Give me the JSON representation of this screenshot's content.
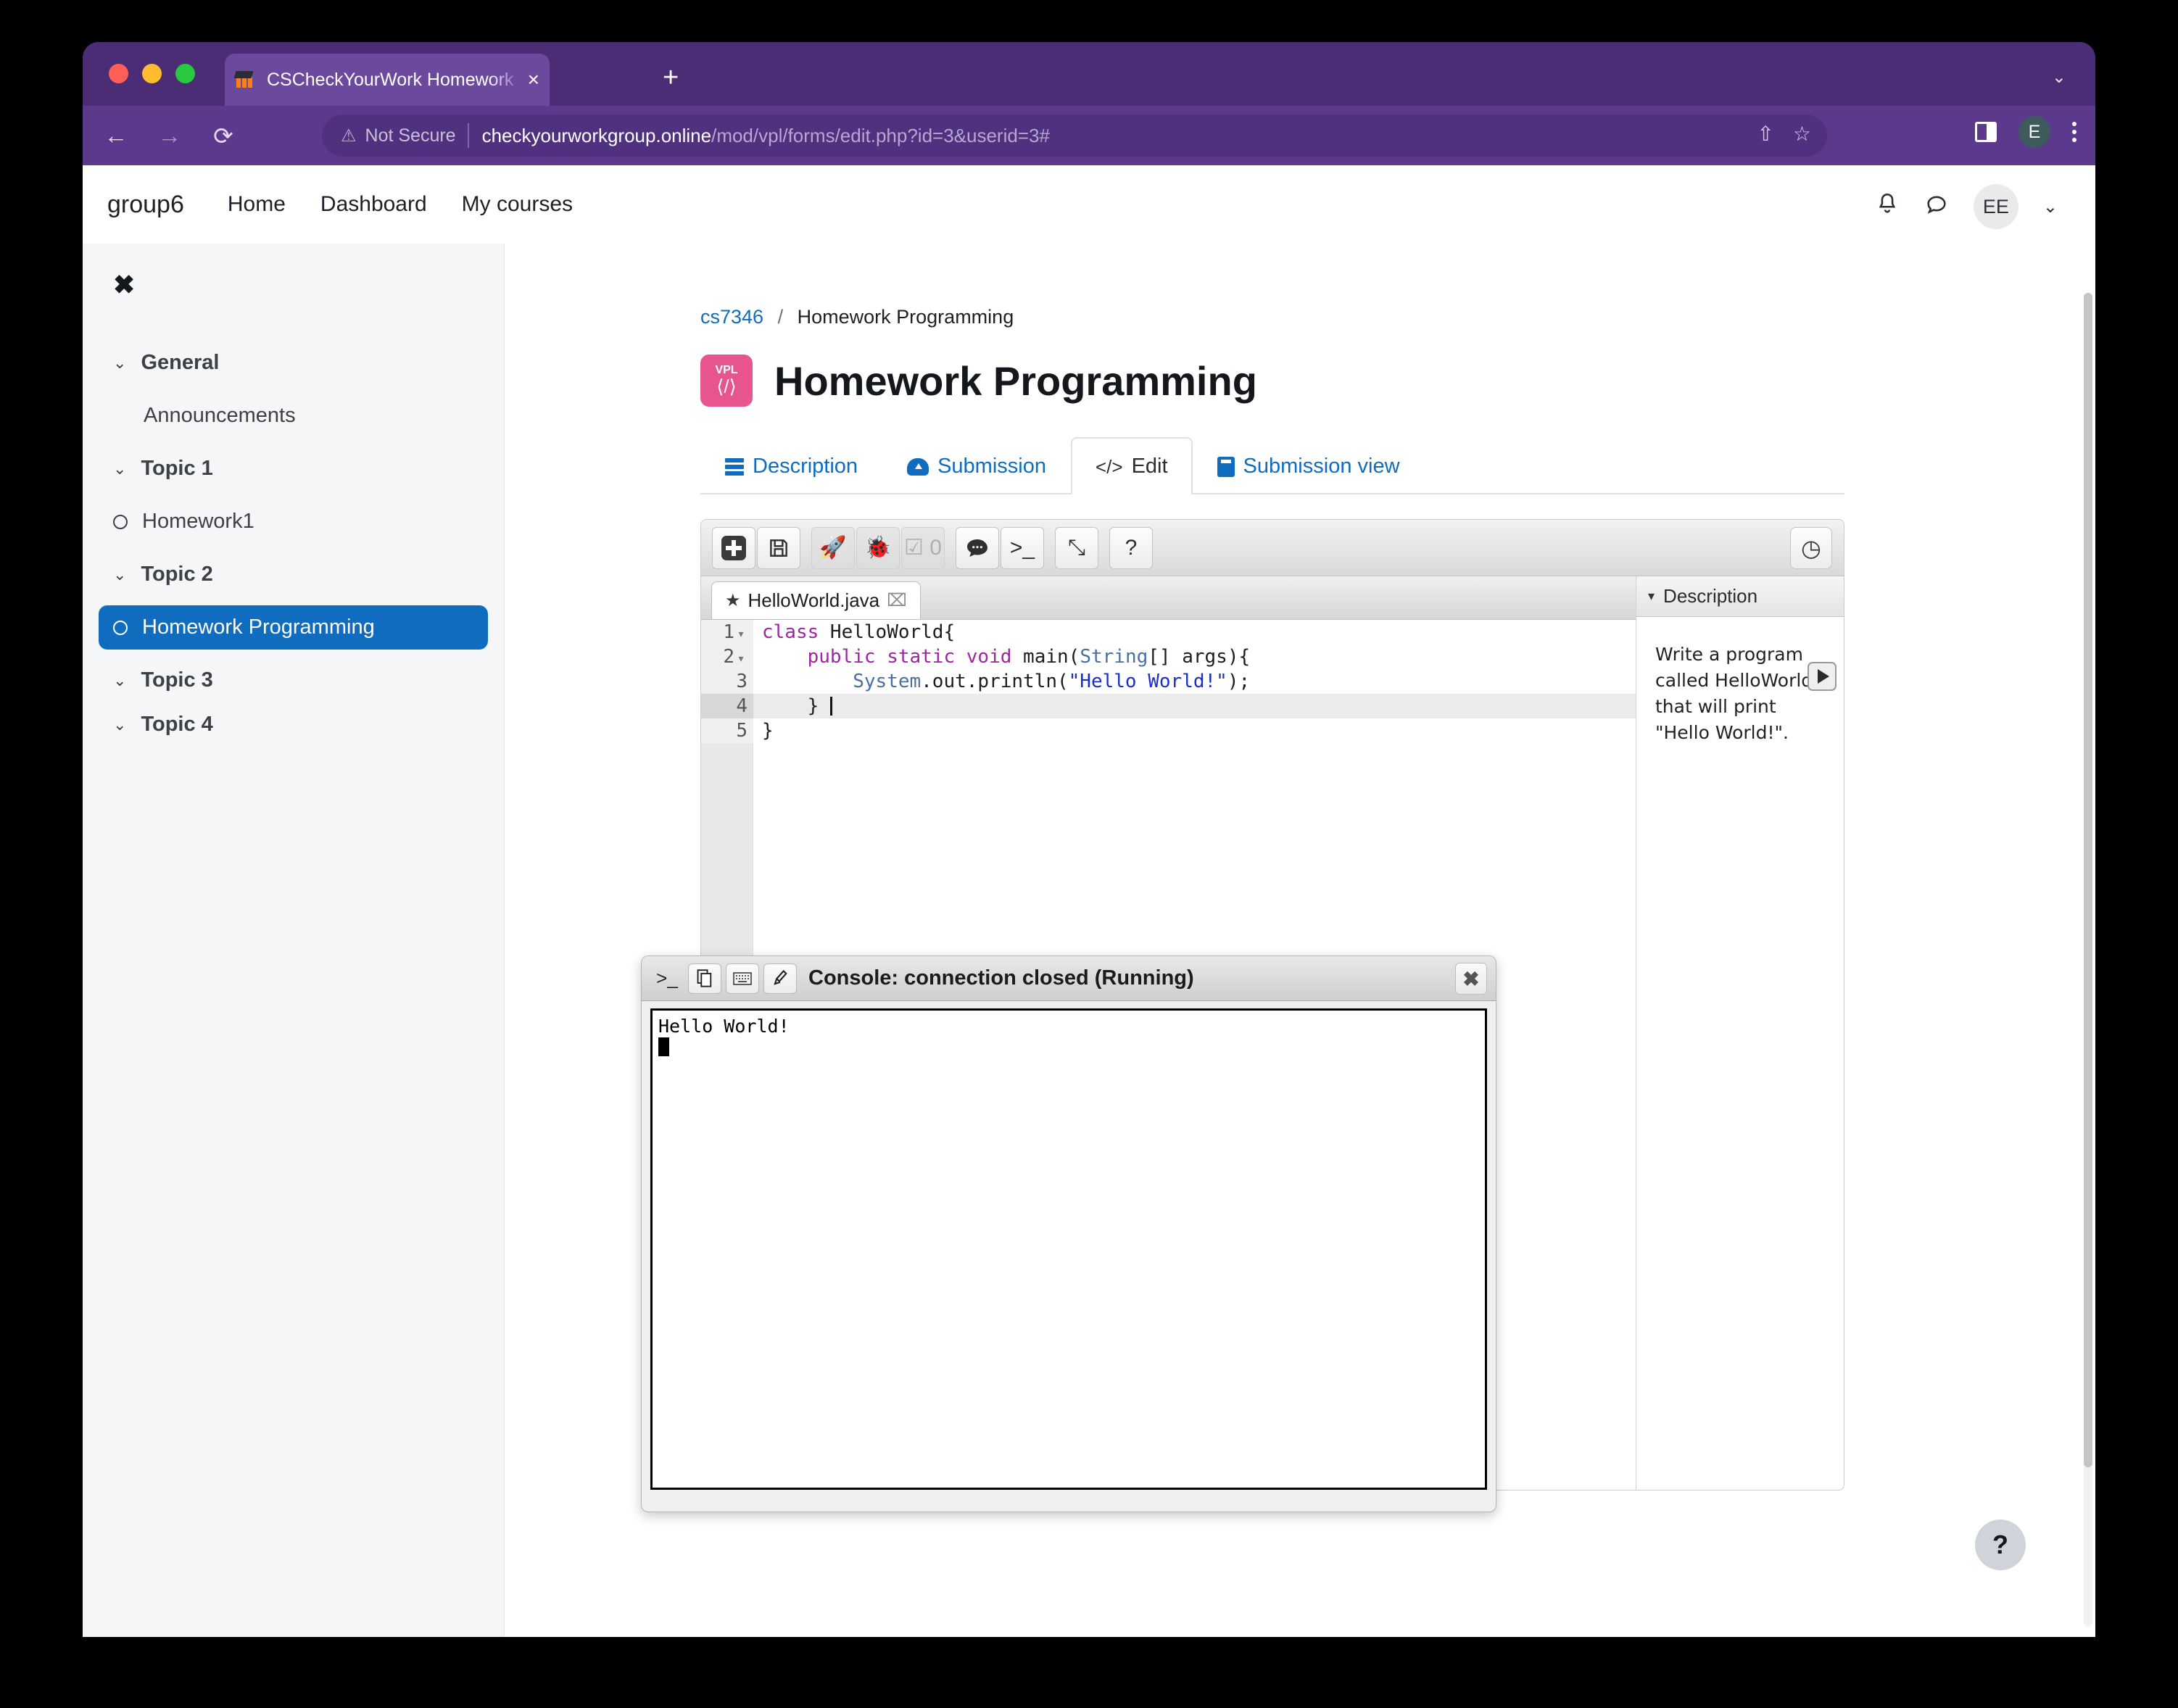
{
  "browser": {
    "tab_title": "CSCheckYourWork Homework",
    "tab_close": "×",
    "new_tab": "+",
    "tabstrip_chevron": "⌄",
    "back": "←",
    "forward": "→",
    "reload": "⟳",
    "warn_glyph": "⚠",
    "security_label": "Not Secure",
    "url_host": "checkyourworkgroup.online",
    "url_path": "/mod/vpl/forms/edit.php?id=3&userid=3#",
    "share_icon": "⇧",
    "bookmark_icon": "☆",
    "profile_initial": "E"
  },
  "moodle_nav": {
    "brand": "group6",
    "links": [
      "Home",
      "Dashboard",
      "My courses"
    ],
    "bell": "🔔",
    "message": "💬",
    "avatar_initials": "EE",
    "chevron": "⌄"
  },
  "course_index": {
    "close_glyph": "✖",
    "chevron": "⌄",
    "entries": [
      {
        "type": "section",
        "label": "General"
      },
      {
        "type": "item",
        "label": "Announcements",
        "bullet": false,
        "active": false
      },
      {
        "type": "section",
        "label": "Topic 1"
      },
      {
        "type": "item",
        "label": "Homework1",
        "bullet": true,
        "active": false
      },
      {
        "type": "section",
        "label": "Topic 2"
      },
      {
        "type": "item",
        "label": "Homework Programming",
        "bullet": true,
        "active": true
      },
      {
        "type": "section",
        "label": "Topic 3"
      },
      {
        "type": "section",
        "label": "Topic 4"
      }
    ]
  },
  "breadcrumb": {
    "course": "cs7346",
    "separator": "/",
    "current": "Homework Programming"
  },
  "page_title": "Homework Programming",
  "vpl_badge": {
    "label": "VPL",
    "glyph": "⟨/⟩"
  },
  "tabs": [
    {
      "label": "Description",
      "icon": "description-icon",
      "active": false
    },
    {
      "label": "Submission",
      "icon": "cloud-upload-icon",
      "active": false
    },
    {
      "label": "Edit",
      "icon": "code-icon",
      "active": true
    },
    {
      "label": "Submission view",
      "icon": "submission-view-icon",
      "active": false
    }
  ],
  "ide": {
    "toolbar": [
      {
        "name": "new-file",
        "glyph": "",
        "disabled": false
      },
      {
        "name": "save",
        "glyph": "💾",
        "disabled": false
      },
      {
        "name": "run",
        "glyph": "🚀",
        "disabled": true
      },
      {
        "name": "debug",
        "glyph": "🐞",
        "disabled": true
      },
      {
        "name": "evaluate",
        "glyph": "☑ 0",
        "disabled": true
      },
      {
        "name": "comments",
        "glyph": "💬",
        "disabled": false
      },
      {
        "name": "console",
        "glyph": ">_",
        "disabled": false
      },
      {
        "name": "fullscreen",
        "glyph": "⤡",
        "disabled": false
      },
      {
        "name": "help",
        "glyph": "?",
        "disabled": false
      }
    ],
    "timer_glyph": "◷",
    "file_tab": {
      "star": "★",
      "name": "HelloWorld.java",
      "close": "⌧"
    },
    "code_lines": [
      {
        "num": "1",
        "fold": "▾",
        "active": false,
        "tokens": [
          {
            "t": "class ",
            "c": "kw"
          },
          {
            "t": "HelloWorld{",
            "c": "plain"
          }
        ]
      },
      {
        "num": "2",
        "fold": "▾",
        "active": false,
        "tokens": [
          {
            "t": "    ",
            "c": "plain"
          },
          {
            "t": "public static void ",
            "c": "kw"
          },
          {
            "t": "main(",
            "c": "plain"
          },
          {
            "t": "String",
            "c": "type"
          },
          {
            "t": "[] args){",
            "c": "plain"
          }
        ]
      },
      {
        "num": "3",
        "fold": "",
        "active": false,
        "tokens": [
          {
            "t": "        ",
            "c": "plain"
          },
          {
            "t": "System",
            "c": "type"
          },
          {
            "t": ".out.println(",
            "c": "plain"
          },
          {
            "t": "\"Hello World!\"",
            "c": "str"
          },
          {
            "t": ");",
            "c": "plain"
          }
        ]
      },
      {
        "num": "4",
        "fold": "",
        "active": true,
        "tokens": [
          {
            "t": "    } ",
            "c": "plain"
          }
        ]
      },
      {
        "num": "5",
        "fold": "",
        "active": false,
        "tokens": [
          {
            "t": "}",
            "c": "plain"
          }
        ]
      }
    ],
    "description_panel": {
      "header": "Description",
      "caret": "▾",
      "text": "Write a program called HelloWorld that will print \"Hello World!\"."
    }
  },
  "console": {
    "title": "Console: connection closed (Running)",
    "icons": [
      ">_",
      "🗉",
      "⌨",
      "🖌"
    ],
    "close": "✖",
    "output": "Hello World!"
  },
  "help_fab": "?",
  "colors": {
    "browser_chrome": "#5b3a8e",
    "moodle_accent": "#0f6cbf",
    "vpl_pink": "#e8558e",
    "keyword": "#9c27a0",
    "type": "#4a6fa5",
    "string": "#1b2ec8"
  }
}
